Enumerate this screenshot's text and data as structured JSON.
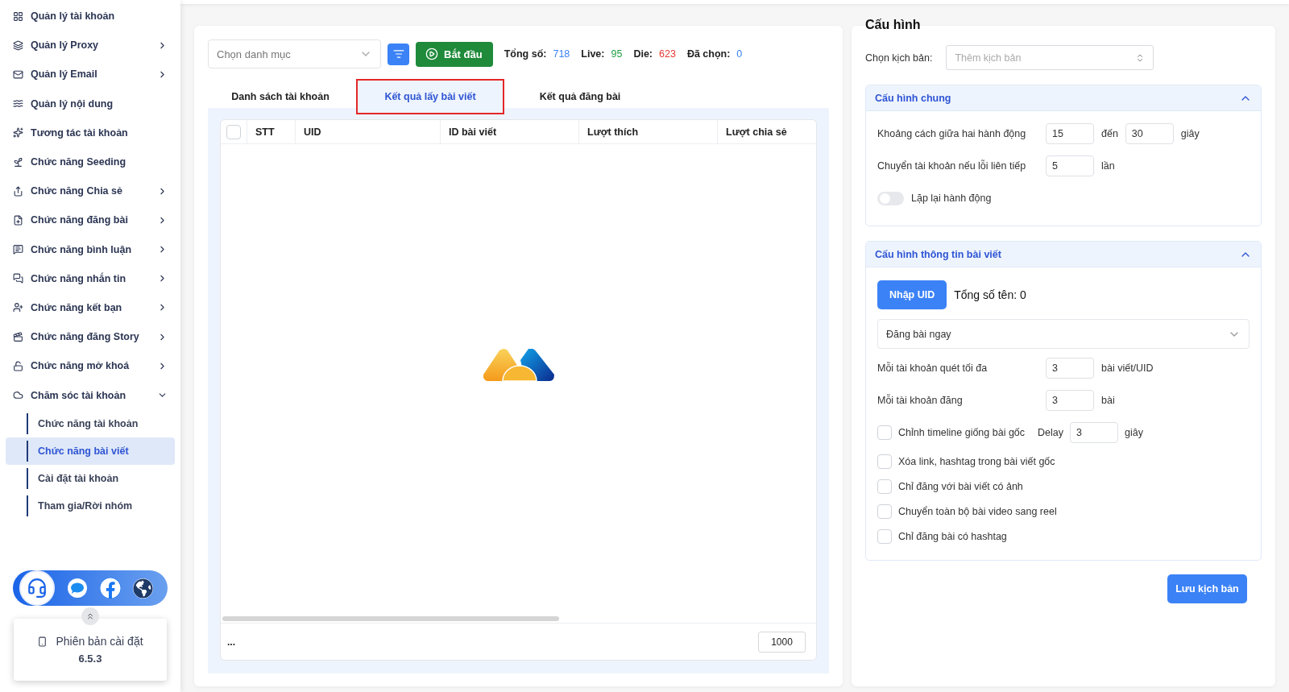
{
  "sidebar": {
    "items": [
      {
        "label": "Quản lý tài khoản",
        "kind": "link"
      },
      {
        "label": "Quản lý Proxy",
        "kind": "group",
        "expanded": false
      },
      {
        "label": "Quản lý Email",
        "kind": "group",
        "expanded": false
      },
      {
        "label": "Quản lý nội dung",
        "kind": "link"
      },
      {
        "label": "Tương tác tài khoản",
        "kind": "link"
      },
      {
        "label": "Chức năng Seeding",
        "kind": "link"
      },
      {
        "label": "Chức năng Chia sẻ",
        "kind": "group",
        "expanded": false
      },
      {
        "label": "Chức năng đăng bài",
        "kind": "group",
        "expanded": false
      },
      {
        "label": "Chức năng bình luận",
        "kind": "group",
        "expanded": false
      },
      {
        "label": "Chức năng nhắn tin",
        "kind": "group",
        "expanded": false
      },
      {
        "label": "Chức năng kết bạn",
        "kind": "group",
        "expanded": false
      },
      {
        "label": "Chức năng đăng Story",
        "kind": "group",
        "expanded": false
      },
      {
        "label": "Chức năng mở khoá",
        "kind": "group",
        "expanded": false
      },
      {
        "label": "Chăm sóc tài khoản",
        "kind": "group",
        "expanded": true,
        "children": [
          {
            "label": "Chức năng tài khoản",
            "selected": false
          },
          {
            "label": "Chức năng bài viết",
            "selected": true
          },
          {
            "label": "Cài đặt tài khoản",
            "selected": false
          },
          {
            "label": "Tham gia/Rời nhóm",
            "selected": false
          }
        ]
      }
    ],
    "version": {
      "label": "Phiên bản cài đặt",
      "number": "6.5.3"
    }
  },
  "toolbar": {
    "category": {
      "placeholder": "Chọn danh mục"
    },
    "start_button": "Bắt đầu",
    "stats": [
      {
        "label": "Tổng số:",
        "value": "718",
        "color": "#3b82f6"
      },
      {
        "label": "Live:",
        "value": "95",
        "color": "#22a045"
      },
      {
        "label": "Die:",
        "value": "623",
        "color": "#e53935"
      },
      {
        "label": "Đã chọn:",
        "value": "0",
        "color": "#3b82f6"
      }
    ]
  },
  "tabs": [
    {
      "label": "Danh sách tài khoản",
      "selected": false
    },
    {
      "label": "Kết quả lấy bài viết",
      "selected": true
    },
    {
      "label": "Kết quả đăng bài",
      "selected": false
    }
  ],
  "table": {
    "columns": [
      "STT",
      "UID",
      "ID bài viết",
      "Lượt thích",
      "Lượt chia sẻ"
    ],
    "all_checked": false,
    "footer_text": "...",
    "page_size": "1000"
  },
  "config": {
    "title": "Cấu hình",
    "script_label": "Chọn kịch bản:",
    "script_placeholder": "Thêm kịch bản",
    "sections": [
      {
        "title": "Cấu hình chung",
        "expanded": true,
        "rows": [
          {
            "kind": "range",
            "label": "Khoảng cách giữa hai hành động",
            "value": "15",
            "joiner": "đến",
            "value2": "30",
            "unit": "giây"
          },
          {
            "kind": "number",
            "label": "Chuyển tài khoản nếu lỗi liên tiếp",
            "value": "5",
            "unit": "lần"
          },
          {
            "kind": "toggle",
            "label": "Lặp lại hành động",
            "on": false
          }
        ]
      },
      {
        "title": "Cấu hình thông tin bài viết",
        "expanded": true,
        "rows": [
          {
            "kind": "uid",
            "button": "Nhập UID",
            "text": "Tổng số tên: 0"
          },
          {
            "kind": "select",
            "value": "Đăng bài ngay"
          },
          {
            "kind": "number",
            "label": "Mỗi tài khoản quét tối đa",
            "value": "3",
            "unit": "bài viết/UID"
          },
          {
            "kind": "number",
            "label": "Mỗi tài khoản đăng",
            "value": "3",
            "unit": "bài"
          },
          {
            "kind": "check_delay",
            "label": "Chỉnh timeline giống bài gốc",
            "checked": false,
            "delay_label": "Delay",
            "value": "3",
            "unit": "giây"
          },
          {
            "kind": "check",
            "label": "Xóa link, hashtag trong bài viết gốc",
            "checked": false
          },
          {
            "kind": "check",
            "label": "Chỉ đăng với bài viết có ảnh",
            "checked": false
          },
          {
            "kind": "check",
            "label": "Chuyển toàn bộ bài video sang reel",
            "checked": false
          },
          {
            "kind": "check",
            "label": "Chỉ đăng bài có hashtag",
            "checked": false
          }
        ]
      }
    ],
    "save_button": "Lưu kịch bản"
  }
}
